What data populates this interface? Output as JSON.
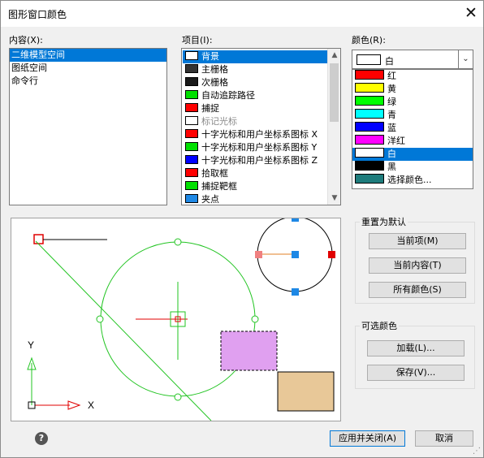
{
  "window": {
    "title": "图形窗口颜色",
    "close_glyph": "✕"
  },
  "context": {
    "label": "内容(X):",
    "items": [
      "二维模型空间",
      "图纸空间",
      "命令行"
    ],
    "selected": 0
  },
  "elements": {
    "label": "项目(I):",
    "items": [
      {
        "label": "背景",
        "color": "#ffffff",
        "selected": true
      },
      {
        "label": "主栅格",
        "color": "#333333"
      },
      {
        "label": "次栅格",
        "color": "#1a1a1a"
      },
      {
        "label": "自动追踪路径",
        "color": "#00e000"
      },
      {
        "label": "捕捉",
        "color": "#ff0000"
      },
      {
        "label": "标记光标",
        "color": "#ffffff",
        "dim": true
      },
      {
        "label": "十字光标和用户坐标系图标 X",
        "color": "#ff0000"
      },
      {
        "label": "十字光标和用户坐标系图标 Y",
        "color": "#00e000"
      },
      {
        "label": "十字光标和用户坐标系图标 Z",
        "color": "#0000ff"
      },
      {
        "label": "拾取框",
        "color": "#ff0000"
      },
      {
        "label": "捕捉靶框",
        "color": "#00e000"
      },
      {
        "label": "夹点",
        "color": "#1e88e5"
      }
    ]
  },
  "color": {
    "label": "颜色(R):",
    "current": "白",
    "current_color": "#ffffff",
    "options": [
      {
        "label": "红",
        "color": "#ff0000"
      },
      {
        "label": "黄",
        "color": "#ffff00"
      },
      {
        "label": "绿",
        "color": "#00ff00"
      },
      {
        "label": "青",
        "color": "#00ffff"
      },
      {
        "label": "蓝",
        "color": "#0000ff"
      },
      {
        "label": "洋红",
        "color": "#ff00ff"
      },
      {
        "label": "白",
        "color": "#ffffff",
        "selected": true
      },
      {
        "label": "黑",
        "color": "#000000"
      },
      {
        "label": "选择颜色...",
        "color": "#1e7c7c"
      }
    ]
  },
  "reset_group": {
    "title": "重置为默认",
    "current_element": "当前项(M)",
    "current_context": "当前内容(T)",
    "all_colors": "所有颜色(S)"
  },
  "optional_group": {
    "title": "可选颜色",
    "load": "加载(L)...",
    "save": "保存(V)..."
  },
  "preview": {
    "axis_y": "Y",
    "axis_x": "X"
  },
  "footer": {
    "apply": "应用并关闭(A)",
    "cancel": "取消",
    "help_glyph": "?"
  }
}
